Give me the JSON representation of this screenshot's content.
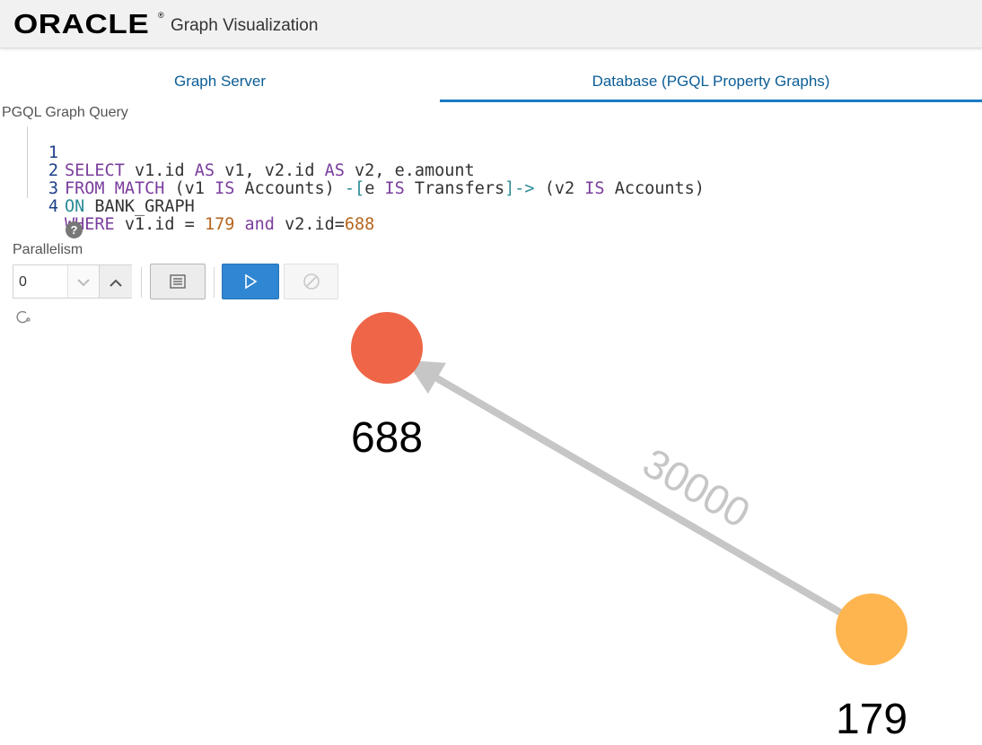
{
  "header": {
    "logo": "ORACLE",
    "app_title": "Graph Visualization"
  },
  "tabs": [
    {
      "label": "Graph Server",
      "active": false
    },
    {
      "label": "Database (PGQL Property Graphs)",
      "active": true
    }
  ],
  "query": {
    "label": "PGQL Graph Query",
    "line_numbers": [
      "1",
      "2",
      "3",
      "4"
    ],
    "lines": [
      "SELECT v1.id AS v1, v2.id AS v2, e.amount",
      "FROM MATCH (v1 IS Accounts) -[e IS Transfers]-> (v2 IS Accounts)",
      "ON BANK_GRAPH",
      "WHERE v1.id = 179 and v2.id=688"
    ]
  },
  "controls": {
    "help_icon": "question-icon",
    "parallelism_label": "Parallelism",
    "parallelism_value": "0",
    "buttons": [
      "list-icon",
      "play-icon",
      "cancel-icon"
    ]
  },
  "graph": {
    "nodes": [
      {
        "id": "688",
        "label": "688",
        "color": "#ee6547"
      },
      {
        "id": "179",
        "label": "179",
        "color": "#feb54f"
      }
    ],
    "edges": [
      {
        "from": "179",
        "to": "688",
        "label": "30000",
        "color": "#c6c6c6"
      }
    ]
  },
  "colors": {
    "accent": "#1a7bc4",
    "run_button": "#2f86d2",
    "tab_text": "#0b5d96"
  }
}
